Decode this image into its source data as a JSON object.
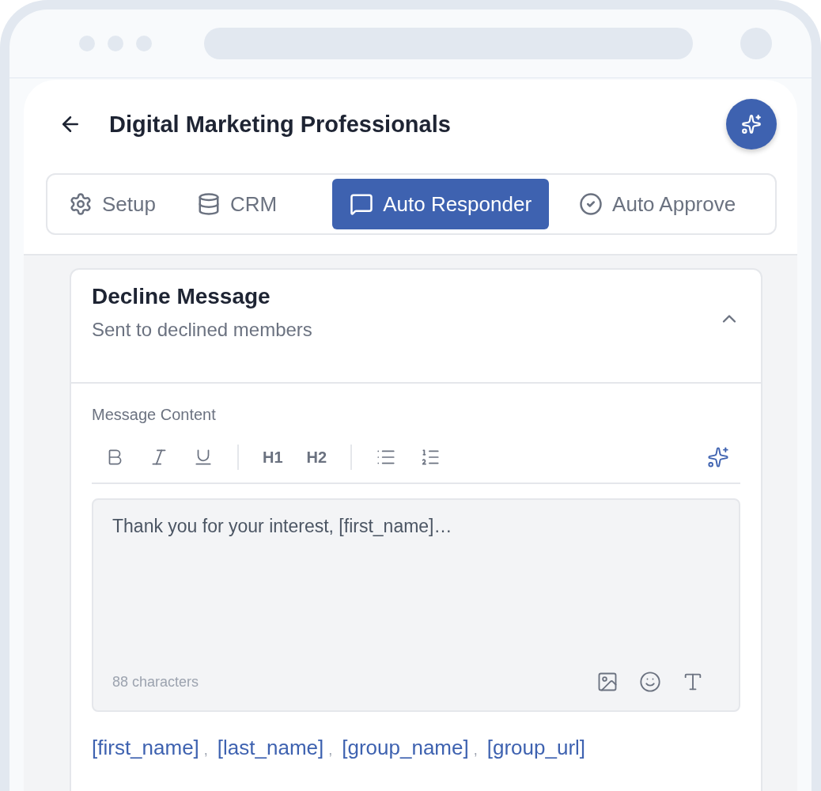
{
  "header": {
    "title": "Digital Marketing Professionals"
  },
  "tabs": [
    {
      "label": "Setup",
      "kind": "gear",
      "selected": false
    },
    {
      "label": "CRM",
      "kind": "database",
      "selected": false
    },
    {
      "label": "Auto Responder",
      "kind": "message",
      "selected": true
    },
    {
      "label": "Auto Approve",
      "kind": "check",
      "selected": false
    }
  ],
  "section": {
    "title": "Decline Message",
    "subtitle": "Sent to declined members",
    "expanded": true,
    "field_label": "Message Content",
    "toolbar": [
      {
        "kind": "bold"
      },
      {
        "kind": "italic"
      },
      {
        "kind": "underline"
      },
      {
        "kind": "divider"
      },
      {
        "kind": "text",
        "label": "H1"
      },
      {
        "kind": "text",
        "label": "H2"
      },
      {
        "kind": "divider"
      },
      {
        "kind": "bullets"
      },
      {
        "kind": "numbers"
      }
    ],
    "message": "Thank you for your interest, [first_name]…",
    "char_count": "88 characters",
    "variables": [
      "[first_name]",
      "[last_name]",
      "[group_name]",
      "[group_url]"
    ],
    "separator": ","
  }
}
